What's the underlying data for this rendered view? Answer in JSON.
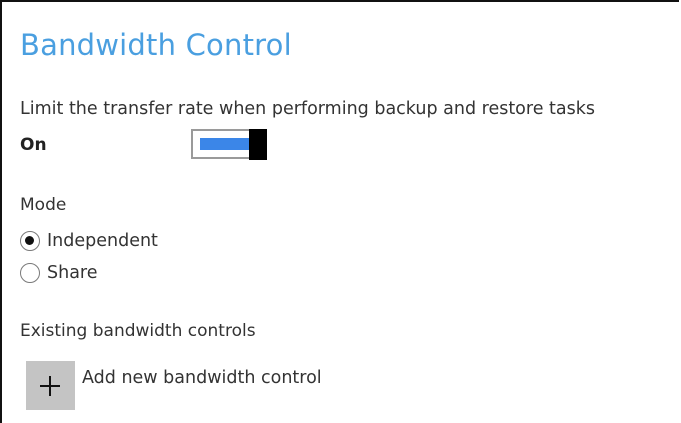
{
  "section": {
    "title": "Bandwidth Control",
    "description": "Limit the transfer rate when performing backup and restore tasks"
  },
  "limit_toggle": {
    "state_label": "On",
    "enabled": true,
    "fill_color": "#3b86e8"
  },
  "mode": {
    "label": "Mode",
    "options": [
      {
        "label": "Independent",
        "selected": true
      },
      {
        "label": "Share",
        "selected": false
      }
    ]
  },
  "existing": {
    "label": "Existing bandwidth controls",
    "add_label": "Add new bandwidth control",
    "add_icon": "plus-icon"
  },
  "colors": {
    "title": "#4a9fe0",
    "add_button_bg": "#c4c4c4"
  }
}
